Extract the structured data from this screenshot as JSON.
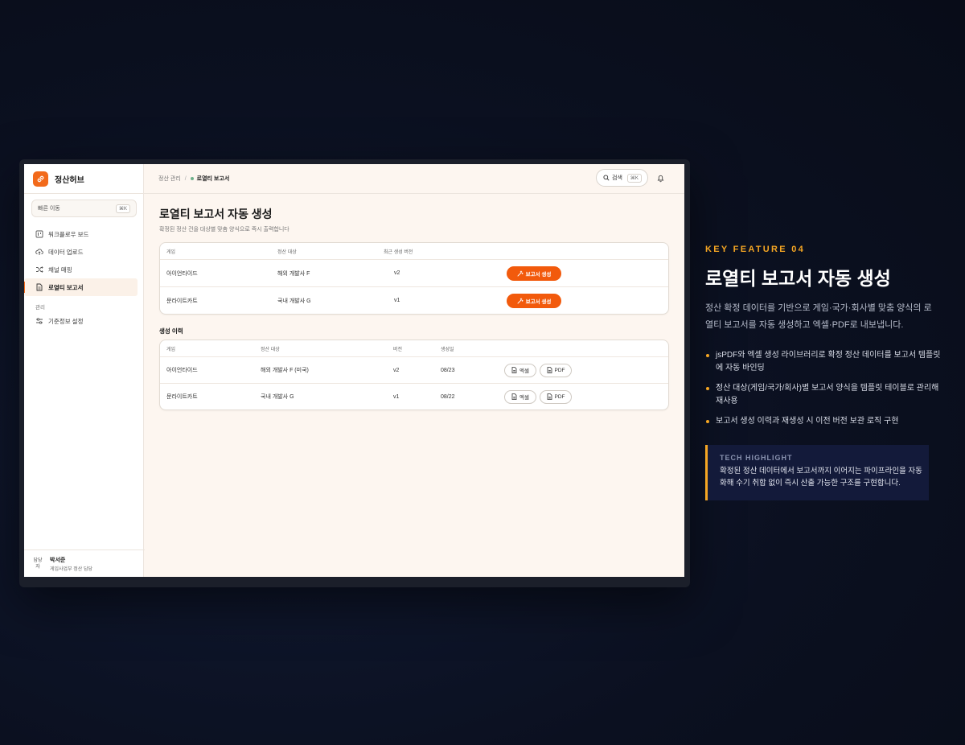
{
  "app": {
    "brand": "정산허브",
    "quick_nav": {
      "label": "빠른 이동",
      "shortcut": "⌘K"
    },
    "nav": [
      {
        "label": "워크플로우 보드",
        "icon": "board-icon"
      },
      {
        "label": "데이터 업로드",
        "icon": "cloud-upload-icon"
      },
      {
        "label": "채널 매핑",
        "icon": "shuffle-icon"
      },
      {
        "label": "로열티 보고서",
        "icon": "document-icon",
        "active": true
      }
    ],
    "nav_section": "관리",
    "nav_admin": [
      {
        "label": "기준정보 설정",
        "icon": "sliders-icon"
      }
    ],
    "user": {
      "avatar_alt": "담당자",
      "name": "박서준",
      "role": "게임사업부 정산 담당"
    },
    "breadcrumb": {
      "parent": "정산 관리",
      "separator": "/",
      "current": "로열티 보고서"
    },
    "search": {
      "label": "검색",
      "shortcut": "⌘K"
    },
    "page": {
      "title": "로열티 보고서 자동 생성",
      "subtitle": "확정된 정산 건을 대상별 맞춤 양식으로 즉시 출력합니다"
    },
    "targets_table": {
      "headers": [
        "게임",
        "정산 대상",
        "최근 생성 버전"
      ],
      "rows": [
        {
          "game": "아이언타이드",
          "target": "해외 개발사 F",
          "version": "v2",
          "action": "보고서 생성"
        },
        {
          "game": "문라이트카트",
          "target": "국내 개발사 G",
          "version": "v1",
          "action": "보고서 생성"
        }
      ]
    },
    "history": {
      "title": "생성 이력",
      "headers": [
        "게임",
        "정산 대상",
        "버전",
        "생성일"
      ],
      "rows": [
        {
          "game": "아이언타이드",
          "target": "해외 개발사 F (미국)",
          "version": "v2",
          "date": "08/23",
          "excel": "엑셀",
          "pdf": "PDF"
        },
        {
          "game": "문라이트카트",
          "target": "국내 개발사 G",
          "version": "v1",
          "date": "08/22",
          "excel": "엑셀",
          "pdf": "PDF"
        }
      ]
    }
  },
  "feature": {
    "eyebrow": "KEY FEATURE 04",
    "title": "로열티 보고서 자동 생성",
    "description": "정산 확정 데이터를 기반으로 게임·국가·회사별 맞춤 양식의 로열티 보고서를 자동 생성하고 엑셀·PDF로 내보냅니다.",
    "bullets": [
      "jsPDF와 엑셀 생성 라이브러리로 확정 정산 데이터를 보고서 템플릿에 자동 바인딩",
      "정산 대상(게임/국가/회사)별 보고서 양식을 템플릿 테이블로 관리해 재사용",
      "보고서 생성 이력과 재생성 시 이전 버전 보관 로직 구현"
    ],
    "tech_highlight": {
      "label": "TECH HIGHLIGHT",
      "text": "확정된 정산 데이터에서 보고서까지 이어지는 파이프라인을 자동화해 수기 취합 없이 즉시 산출 가능한 구조를 구현합니다."
    }
  },
  "colors": {
    "accent": "#f25a0c",
    "highlight": "#f5a623",
    "background": "#0b1020",
    "app_bg": "#fdf6f0"
  }
}
